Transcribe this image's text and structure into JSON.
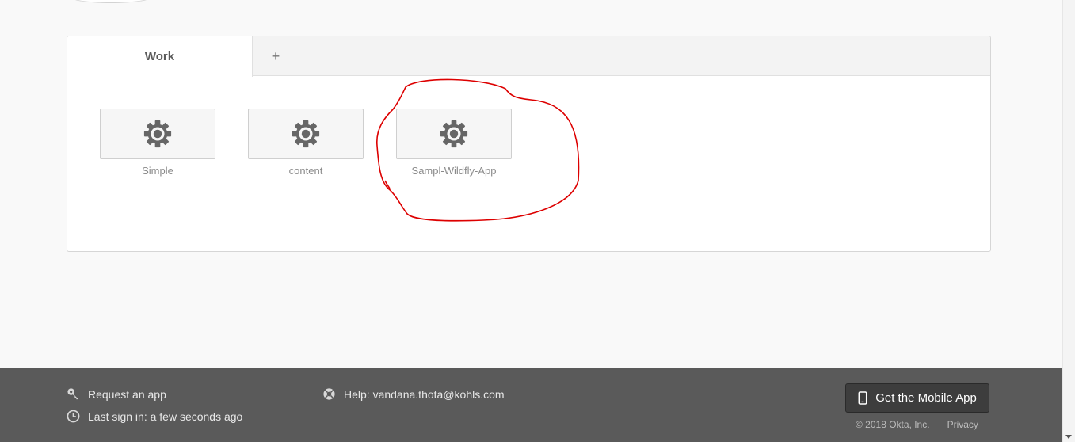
{
  "tabs": [
    {
      "label": "Work",
      "active": true
    },
    {
      "label": "+",
      "active": false
    }
  ],
  "apps": [
    {
      "label": "Simple",
      "icon": "gear-icon"
    },
    {
      "label": "content",
      "icon": "gear-icon"
    },
    {
      "label": "Sampl-Wildfly-App",
      "icon": "gear-icon"
    }
  ],
  "annotation": {
    "shape": "freehand-circle",
    "target": "Sampl-Wildfly-App",
    "color": "#dd0000"
  },
  "footer": {
    "request_app": {
      "label": "Request an app",
      "icon": "key-icon"
    },
    "last_sign_in": {
      "label": "Last sign in: a few seconds ago",
      "icon": "clock-icon"
    },
    "help": {
      "label": "Help: vandana.thota@kohls.com",
      "icon": "lifebuoy-icon"
    },
    "mobile_app": {
      "label": "Get the Mobile App",
      "icon": "phone-icon"
    },
    "copyright": "© 2018 Okta, Inc.",
    "privacy": "Privacy"
  },
  "colors": {
    "page_bg": "#f9f9f9",
    "footer_bg": "#5a5a5a",
    "mobile_button_bg": "#3d3d3d",
    "annotation": "#dd0000"
  }
}
